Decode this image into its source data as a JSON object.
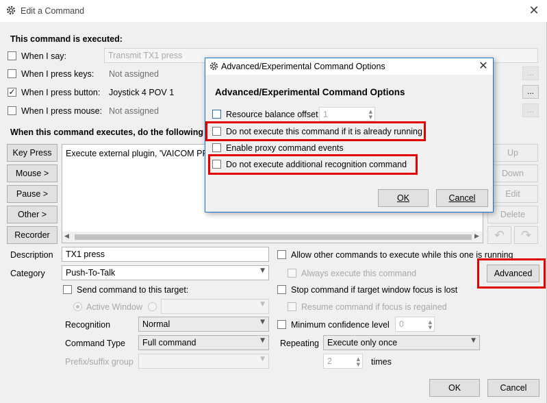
{
  "window": {
    "title": "Edit a Command",
    "close_glyph": "✕"
  },
  "executed": {
    "heading": "This command is executed:",
    "when_say": {
      "label": "When I say:",
      "value": "Transmit TX1 press",
      "checked": false
    },
    "when_keys": {
      "label": "When I press keys:",
      "value": "Not assigned",
      "checked": false
    },
    "when_button": {
      "label": "When I press button:",
      "value": "Joystick 4 POV 1",
      "checked": true
    },
    "when_mouse": {
      "label": "When I press mouse:",
      "value": "Not assigned",
      "checked": false
    },
    "ellipsis": "..."
  },
  "actions": {
    "heading": "When this command executes, do the following se",
    "buttons": [
      "Key Press",
      "Mouse >",
      "Pause >",
      "Other >",
      "Recorder"
    ],
    "list_item": "Execute external plugin, 'VAICOM PRO",
    "right_buttons": [
      "Up",
      "Down",
      "Edit",
      "Delete"
    ]
  },
  "form": {
    "description_label": "Description",
    "description_value": "TX1 press",
    "category_label": "Category",
    "category_value": "Push-To-Talk",
    "send_target_label": "Send command to this target:",
    "active_window_label": "Active Window",
    "recognition_label": "Recognition",
    "recognition_value": "Normal",
    "command_type_label": "Command Type",
    "command_type_value": "Full command",
    "prefix_label": "Prefix/suffix group",
    "allow_other": "Allow other commands to execute while this one is running",
    "always_execute": "Always execute this command",
    "stop_focus": "Stop command if target window focus is lost",
    "resume_focus": "Resume command if focus is regained",
    "min_conf_label": "Minimum confidence level",
    "min_conf_value": "0",
    "repeating_label": "Repeating",
    "repeating_value": "Execute only once",
    "times_value": "2",
    "times_label": "times",
    "advanced_button": "Advanced",
    "ok_button": "OK",
    "cancel_button": "Cancel"
  },
  "dialog": {
    "title": "Advanced/Experimental Command Options",
    "heading": "Advanced/Experimental Command Options",
    "close_glyph": "✕",
    "resource_label": "Resource balance offset",
    "resource_value": "1",
    "not_execute_running": "Do not execute this command if it is already running",
    "enable_proxy": "Enable proxy command events",
    "not_execute_recognition": "Do not execute additional recognition command",
    "ok": "OK",
    "cancel": "Cancel"
  },
  "colors": {
    "highlight": "#e30000",
    "dialog_border": "#1a73c7"
  }
}
